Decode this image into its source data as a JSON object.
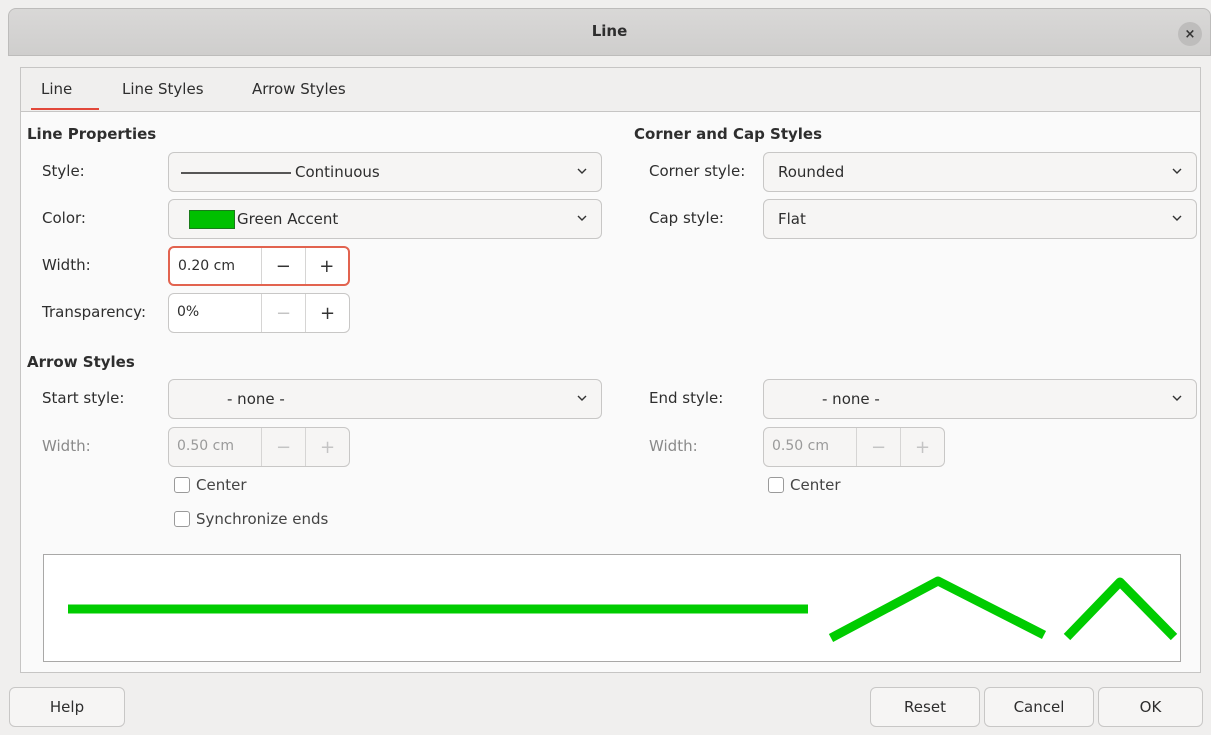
{
  "window": {
    "title": "Line",
    "close_glyph": "×"
  },
  "tabs": [
    {
      "label": "Line"
    },
    {
      "label": "Line Styles"
    },
    {
      "label": "Arrow Styles"
    }
  ],
  "line_properties": {
    "heading": "Line Properties",
    "style_label": "Style:",
    "style_value": "Continuous",
    "color_label": "Color:",
    "color_value": "Green Accent",
    "color_swatch": "#00c000",
    "width_label": "Width:",
    "width_value": "0.20 cm",
    "transparency_label": "Transparency:",
    "transparency_value": "0%"
  },
  "corner_cap": {
    "heading": "Corner and Cap Styles",
    "corner_label": "Corner style:",
    "corner_value": "Rounded",
    "cap_label": "Cap style:",
    "cap_value": "Flat"
  },
  "arrow_styles": {
    "heading": "Arrow Styles",
    "start_label": "Start style:",
    "start_value": "- none -",
    "end_label": "End style:",
    "end_value": "- none -",
    "start_width_label": "Width:",
    "start_width_value": "0.50 cm",
    "end_width_label": "Width:",
    "end_width_value": "0.50 cm",
    "center_label": "Center",
    "end_center_label": "Center",
    "sync_label": "Synchronize ends"
  },
  "spin_glyphs": {
    "minus": "−",
    "plus": "+"
  },
  "preview_color": "#00cc00",
  "buttons": {
    "help": "Help",
    "reset": "Reset",
    "cancel": "Cancel",
    "ok": "OK"
  }
}
